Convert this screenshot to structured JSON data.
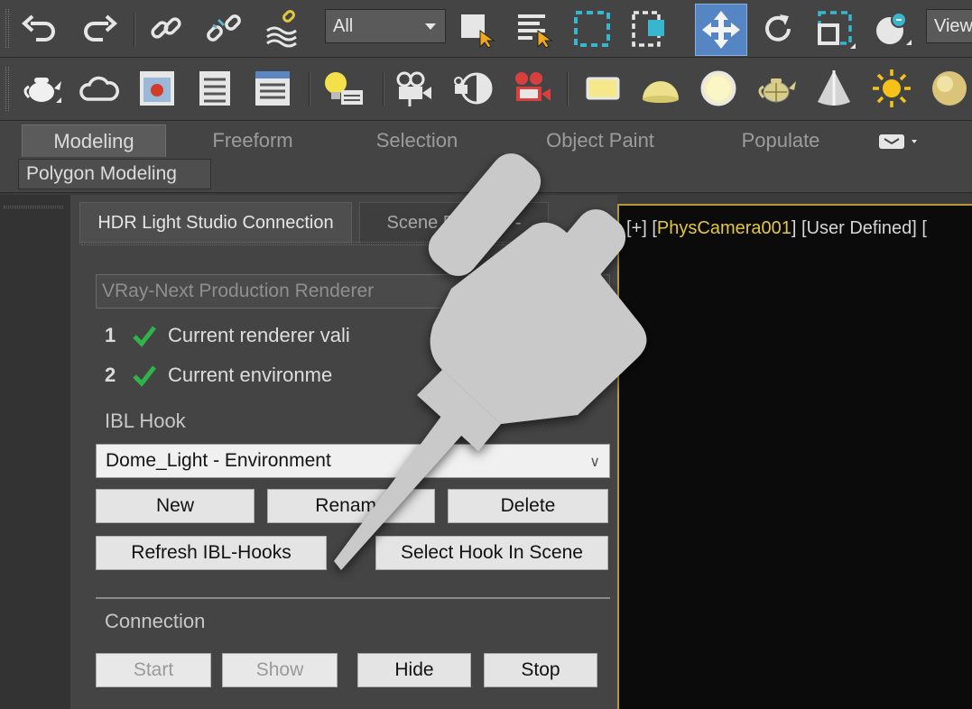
{
  "toolbar_main": {
    "selection_filter": "All",
    "viewport_dropdown": "View",
    "icons": [
      "undo-icon",
      "redo-icon",
      "link-icon",
      "unlink-icon",
      "bind-space-warp-icon",
      "select-object-icon",
      "select-by-name-icon",
      "rectangular-region-icon",
      "window-crossing-icon",
      "move-icon",
      "rotate-icon",
      "scale-icon",
      "snap-icon"
    ]
  },
  "toolbar_render": {
    "icons": [
      "teapot-render-icon",
      "cloud-render-icon",
      "render-frame-icon",
      "render-setup-icon",
      "rendered-frame-window-icon",
      "light-lister-icon",
      "camera-icon",
      "camera-dolly-icon",
      "video-camera-icon",
      "area-light-icon",
      "dome-light-icon",
      "sphere-light-icon",
      "teapot-light-icon",
      "spot-light-icon",
      "sun-icon",
      "sphere-icon"
    ]
  },
  "ribbon": {
    "tabs": [
      "Modeling",
      "Freeform",
      "Selection",
      "Object Paint",
      "Populate"
    ],
    "active_tab": "Modeling",
    "sub_panel": "Polygon Modeling"
  },
  "panel": {
    "tabs": [
      "HDR Light Studio Connection",
      "Scene Explorer -"
    ],
    "renderer": "VRay-Next Production Renderer",
    "checks": [
      {
        "num": "1",
        "text": "Current renderer vali"
      },
      {
        "num": "2",
        "text": "Current environme"
      }
    ],
    "ibl_hook_label": "IBL Hook",
    "hook_selected": "Dome_Light - Environment",
    "buttons": {
      "new": "New",
      "rename": "Rename",
      "delete": "Delete",
      "refresh": "Refresh IBL-Hooks",
      "select_hook": "Select Hook In Scene"
    },
    "connection_label": "Connection",
    "connection_buttons": {
      "start": "Start",
      "show": "Show",
      "hide": "Hide",
      "stop": "Stop"
    }
  },
  "viewport": {
    "prefix": "[+]",
    "bracket_open": "[",
    "camera": "PhysCamera001",
    "bracket_close": "]",
    "mode": "[User Defined]",
    "tail": "["
  },
  "colors": {
    "accent_blue": "#5585c2",
    "viewport_border": "#b59a38",
    "camera_label": "#e3c83e",
    "check_green": "#2fb34a"
  }
}
